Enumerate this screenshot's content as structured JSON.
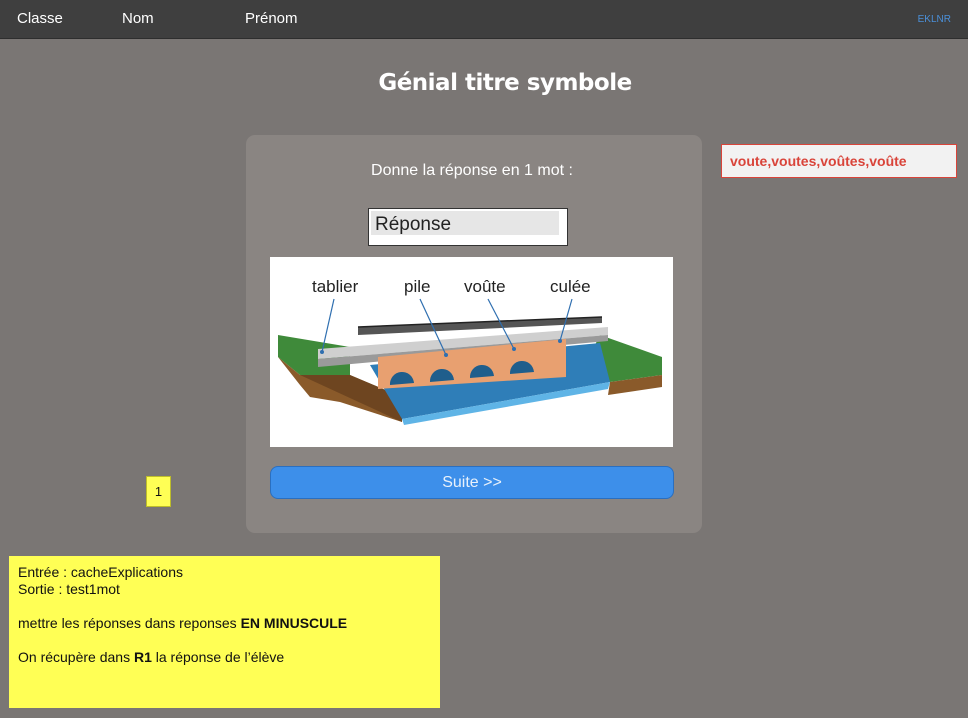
{
  "header": {
    "classe": "Classe",
    "nom": "Nom",
    "prenom": "Prénom",
    "code": "EKLNR"
  },
  "title": "Génial titre symbole",
  "question": {
    "prompt": "Donne la réponse en 1 mot :",
    "answer_value": "Réponse"
  },
  "diagram": {
    "labels": [
      "tablier",
      "pile",
      "voûte",
      "culée"
    ]
  },
  "suite_button": "Suite >>",
  "answers": "voute,voutes,voûtes,voûte",
  "counter": "1",
  "notes": {
    "entree": "Entrée : cacheExplications",
    "sortie": "Sortie : test1mot",
    "line3_pre": "mettre les réponses dans reponses ",
    "line3_bold": "EN MINUSCULE",
    "line4_pre": "On récupère dans ",
    "line4_bold": "R1",
    "line4_post": " la réponse de l’élève"
  },
  "colors": {
    "background": "#7a7674",
    "topbar": "#3f3f3f",
    "card": "#8a8582",
    "button": "#3d8fea",
    "answers_red": "#d9443a",
    "note_yellow": "#ffff55"
  }
}
